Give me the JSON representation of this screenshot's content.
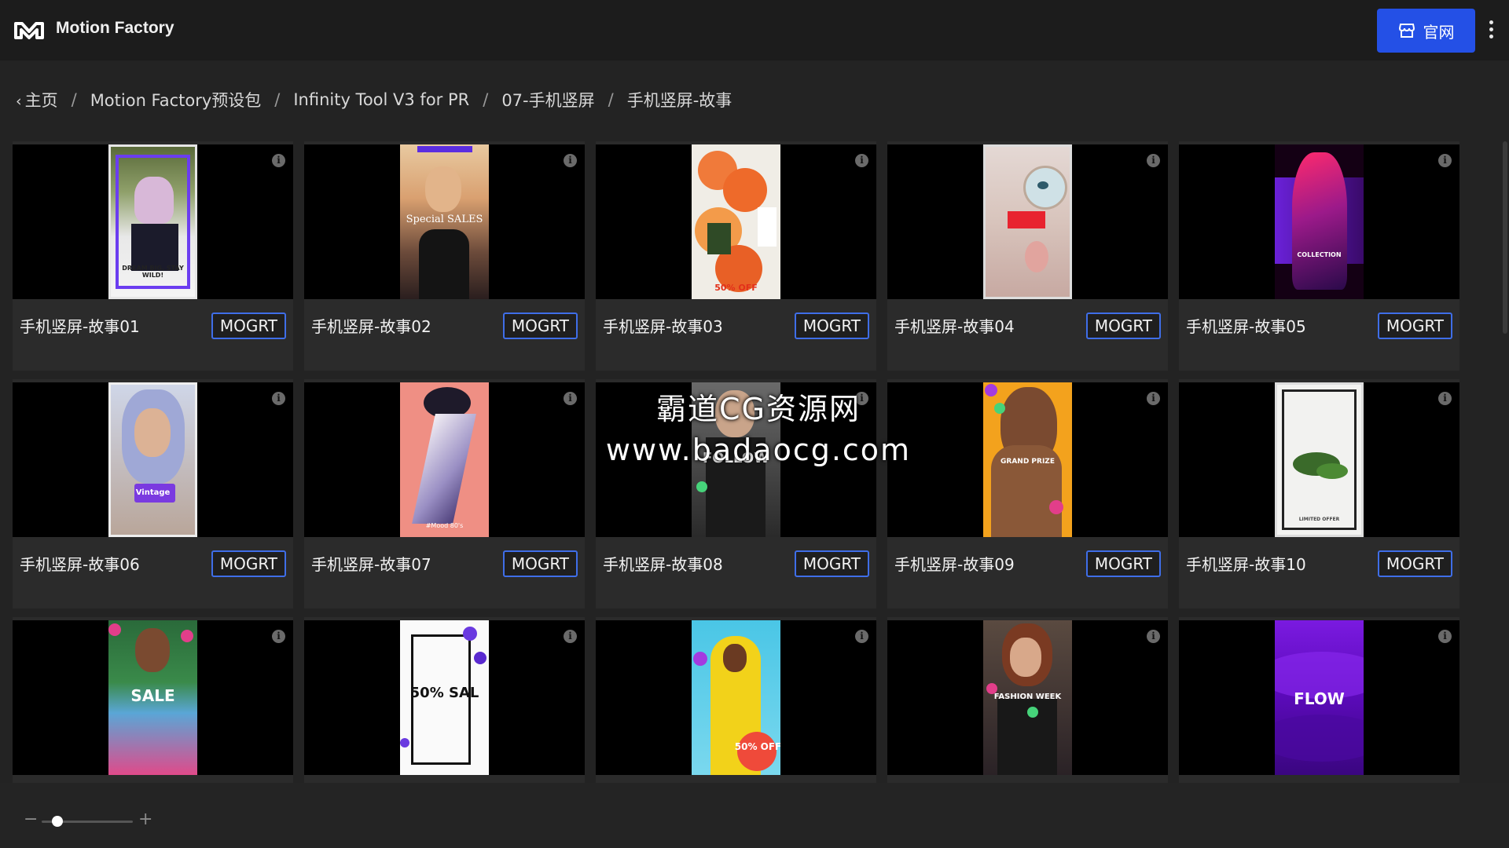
{
  "app": {
    "title": "Motion Factory"
  },
  "header": {
    "site_button_label": "官网"
  },
  "breadcrumb": {
    "back_label": "主页",
    "items": [
      "Motion Factory预设包",
      "Infinity Tool V3 for PR",
      "07-手机竖屏",
      "手机竖屏-故事"
    ]
  },
  "cards": [
    {
      "title": "手机竖屏-故事01",
      "badge": "MOGRT",
      "poster_text": "DREAM BIG, STAY WILD!"
    },
    {
      "title": "手机竖屏-故事02",
      "badge": "MOGRT",
      "poster_text": "Special SALES"
    },
    {
      "title": "手机竖屏-故事03",
      "badge": "MOGRT",
      "poster_text": "50% OFF"
    },
    {
      "title": "手机竖屏-故事04",
      "badge": "MOGRT",
      "poster_text": ""
    },
    {
      "title": "手机竖屏-故事05",
      "badge": "MOGRT",
      "poster_text": "COLLECTION"
    },
    {
      "title": "手机竖屏-故事06",
      "badge": "MOGRT",
      "poster_text": "Vintage"
    },
    {
      "title": "手机竖屏-故事07",
      "badge": "MOGRT",
      "poster_text": "#Mood 80's"
    },
    {
      "title": "手机竖屏-故事08",
      "badge": "MOGRT",
      "poster_text": "FOLLOW"
    },
    {
      "title": "手机竖屏-故事09",
      "badge": "MOGRT",
      "poster_text": "GRAND PRIZE"
    },
    {
      "title": "手机竖屏-故事10",
      "badge": "MOGRT",
      "poster_text": "LIMITED OFFER"
    },
    {
      "title": "",
      "badge": "",
      "poster_text": "SALE"
    },
    {
      "title": "",
      "badge": "",
      "poster_text": "50% SAL"
    },
    {
      "title": "",
      "badge": "",
      "poster_text": "50% OFF"
    },
    {
      "title": "",
      "badge": "",
      "poster_text": "FASHION WEEK"
    },
    {
      "title": "",
      "badge": "",
      "poster_text": "FLOW"
    }
  ],
  "watermark": {
    "line1": "霸道CG资源网",
    "line2": "www.badaocg.com"
  },
  "zoom": {
    "level": 0.17
  },
  "colors": {
    "accent": "#2450e6",
    "badge_border": "#3f6ee8"
  }
}
